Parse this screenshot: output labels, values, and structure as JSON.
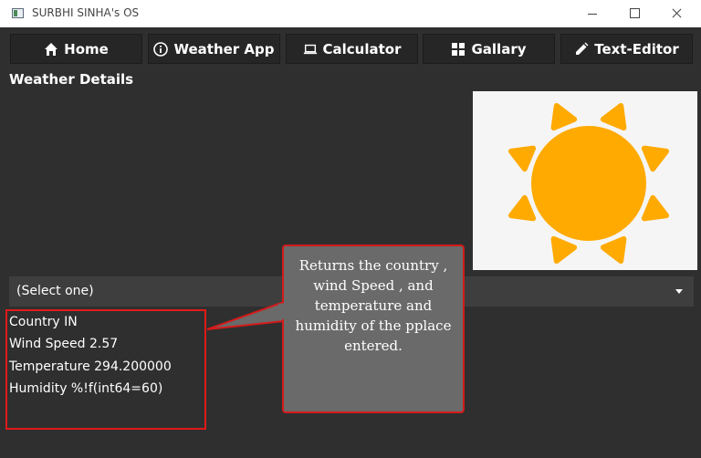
{
  "window": {
    "title": "SURBHI SINHA's OS"
  },
  "nav": {
    "home": "Home",
    "weather": "Weather App",
    "calculator": "Calculator",
    "gallery": "Gallary",
    "editor": "Text-Editor"
  },
  "main": {
    "heading": "Weather Details",
    "select_value": "(Select one)",
    "details": {
      "country": "Country IN",
      "wind": "Wind Speed 2.57",
      "temperature": "Temperature 294.200000",
      "humidity": "Humidity %!f(int64=60)"
    }
  },
  "callout": {
    "text": "Returns the country , wind Speed , and temperature and humidity of the pplace entered."
  },
  "colors": {
    "sun": "#ffaa00",
    "accent_border": "#e11919"
  }
}
